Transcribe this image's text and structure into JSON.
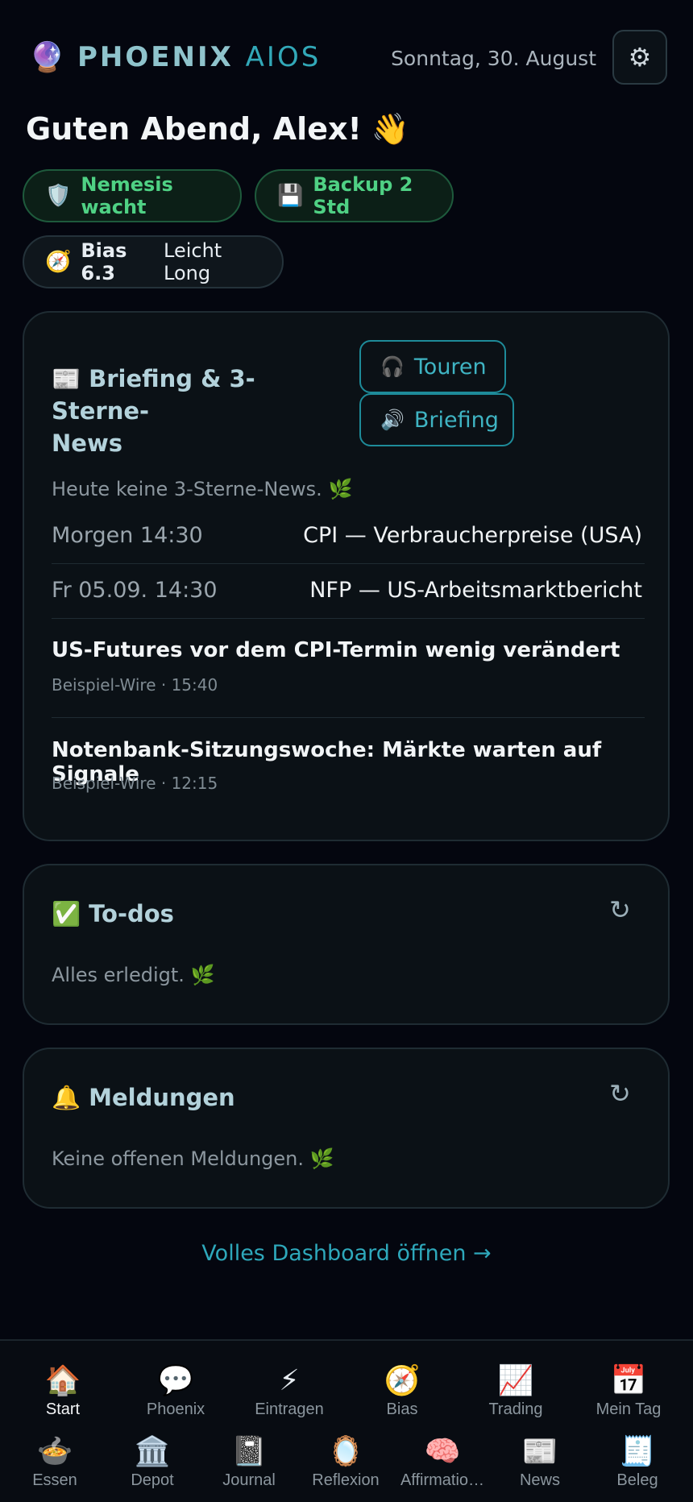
{
  "header": {
    "logo_icon": "🔮",
    "logo_main": "PHOENIX",
    "logo_accent": "AIOS",
    "date": "Sonntag, 30. August",
    "settings_icon": "⚙"
  },
  "greeting": {
    "text": "Guten Abend, Alex!",
    "emoji": "👋"
  },
  "status_pills": {
    "nemesis": {
      "icon": "🛡️",
      "label": "Nemesis wacht"
    },
    "backup": {
      "icon": "💾",
      "label": "Backup 2 Std"
    },
    "bias": {
      "icon": "🧭",
      "value": "Bias 6.3",
      "label": "Leicht Long"
    }
  },
  "briefing": {
    "icon": "📰",
    "title_line1": "Briefing & 3-Sterne-",
    "title_line2": "News",
    "buttons": {
      "touren": {
        "icon": "🎧",
        "label": "Touren"
      },
      "briefing": {
        "icon": "🔊",
        "label": "Briefing"
      }
    },
    "empty_text": "Heute keine 3-Sterne-News.",
    "empty_icon": "🌿",
    "events": [
      {
        "time": "Morgen 14:30",
        "name": "CPI — Verbraucherpreise (USA)"
      },
      {
        "time": "Fr 05.09. 14:30",
        "name": "NFP — US-Arbeitsmarktbericht"
      }
    ],
    "news": [
      {
        "title": "US-Futures vor dem CPI-Termin wenig verändert",
        "meta": "Beispiel-Wire · 15:40"
      },
      {
        "title": "Notenbank-Sitzungswoche: Märkte warten auf Signale",
        "meta": "Beispiel-Wire · 12:15"
      }
    ]
  },
  "todos": {
    "icon": "✅",
    "title": "To-dos",
    "refresh_icon": "↻",
    "empty_text": "Alles erledigt.",
    "empty_icon": "🌿"
  },
  "notifications": {
    "icon": "🔔",
    "title": "Meldungen",
    "refresh_icon": "↻",
    "empty_text": "Keine offenen Meldungen.",
    "empty_icon": "🌿"
  },
  "dashboard_link": "Volles Dashboard öffnen →",
  "nav": {
    "row1": [
      {
        "icon": "🏠",
        "label": "Start"
      },
      {
        "icon": "💬",
        "label": "Phoenix"
      },
      {
        "icon": "⚡",
        "label": "Eintragen"
      },
      {
        "icon": "🧭",
        "label": "Bias"
      },
      {
        "icon": "📈",
        "label": "Trading"
      },
      {
        "icon": "📅",
        "label": "Mein Tag"
      }
    ],
    "row2": [
      {
        "icon": "🍲",
        "label": "Essen"
      },
      {
        "icon": "🏛️",
        "label": "Depot"
      },
      {
        "icon": "📓",
        "label": "Journal"
      },
      {
        "icon": "🪞",
        "label": "Reflexion"
      },
      {
        "icon": "🧠",
        "label": "Affirmatio…"
      },
      {
        "icon": "📰",
        "label": "News"
      },
      {
        "icon": "🧾",
        "label": "Beleg"
      }
    ]
  }
}
